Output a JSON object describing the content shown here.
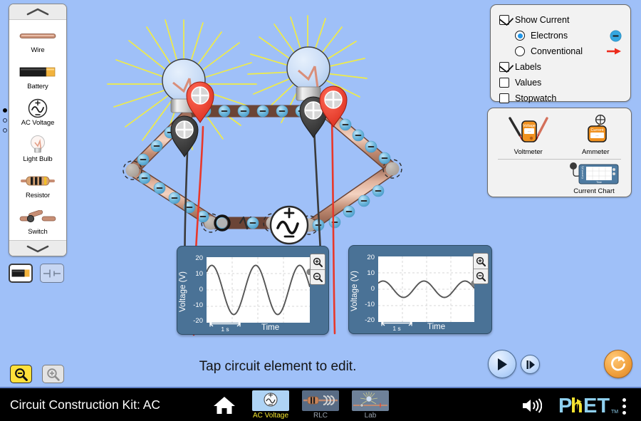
{
  "app": {
    "title": "Circuit Construction Kit: AC",
    "background_color": "#9fc0f8",
    "hint": "Tap circuit element to edit."
  },
  "carousel": {
    "up_arrow_icon": "chevron-up-icon",
    "down_arrow_icon": "chevron-down-icon",
    "items": [
      {
        "label": "Wire",
        "icon": "wire-icon"
      },
      {
        "label": "Battery",
        "icon": "battery-icon"
      },
      {
        "label": "AC Voltage",
        "icon": "ac-voltage-icon"
      },
      {
        "label": "Light Bulb",
        "icon": "light-bulb-icon"
      },
      {
        "label": "Resistor",
        "icon": "resistor-icon"
      },
      {
        "label": "Switch",
        "icon": "switch-icon"
      }
    ],
    "page_dots": [
      true,
      false,
      false
    ]
  },
  "view_toggles": [
    {
      "name": "lifelike-view",
      "icon": "battery-lifelike-icon",
      "selected": true
    },
    {
      "name": "schematic-view",
      "icon": "battery-schematic-icon",
      "selected": false
    }
  ],
  "controls": {
    "show_current": {
      "label": "Show Current",
      "checked": true
    },
    "current_type": {
      "selected": "Electrons",
      "options": [
        {
          "label": "Electrons",
          "selected": true,
          "icon": "electron-icon",
          "color": "#2196e8"
        },
        {
          "label": "Conventional",
          "selected": false,
          "icon": "red-arrow-icon",
          "color": "#e82b1e"
        }
      ]
    },
    "labels": {
      "label": "Labels",
      "checked": true
    },
    "values": {
      "label": "Values",
      "checked": false
    },
    "stopwatch": {
      "label": "Stopwatch",
      "checked": false
    }
  },
  "sensors": [
    {
      "label": "Voltmeter",
      "icon": "voltmeter-icon",
      "display_text": "Voltage"
    },
    {
      "label": "Ammeter",
      "icon": "ammeter-icon",
      "display_text": "Current"
    },
    {
      "label": "Current Chart",
      "icon": "current-chart-icon"
    }
  ],
  "charts": [
    {
      "name": "voltage-chart-1",
      "chart_data": {
        "type": "line",
        "title": "",
        "xlabel": "Time",
        "ylabel": "Voltage (V)",
        "yticks": [
          20,
          10,
          0,
          -10,
          -20
        ],
        "ylim": [
          -20,
          20
        ],
        "scale_bar_label": "1 s",
        "amplitude": 15,
        "cycles": 2.35,
        "phase_deg": 47,
        "end_marker_value": 11,
        "grid": true,
        "series": [
          {
            "name": "voltage",
            "color": "#555555"
          }
        ]
      },
      "zoom_in_icon": "zoom-in-icon",
      "zoom_out_icon": "zoom-out-icon"
    },
    {
      "name": "voltage-chart-2",
      "chart_data": {
        "type": "line",
        "title": "",
        "xlabel": "Time",
        "ylabel": "Voltage (V)",
        "yticks": [
          20,
          10,
          0,
          -10,
          -20
        ],
        "ylim": [
          -20,
          20
        ],
        "scale_bar_label": "1 s",
        "amplitude": 5,
        "cycles": 2.35,
        "phase_deg": 47,
        "end_marker_value": 3.6,
        "grid": true,
        "series": [
          {
            "name": "voltage",
            "color": "#555555"
          }
        ]
      },
      "zoom_in_icon": "zoom-in-icon",
      "zoom_out_icon": "zoom-out-icon"
    }
  ],
  "zoom_controls": {
    "zoom_out": {
      "icon": "zoom-out-icon",
      "active": true,
      "color": "#ffe03a"
    },
    "zoom_in": {
      "icon": "zoom-in-icon",
      "active": false,
      "color": "#e3e3e3"
    }
  },
  "sim_controls": {
    "play": {
      "icon": "play-icon",
      "name": "play-button"
    },
    "step": {
      "icon": "step-forward-icon",
      "name": "step-forward-button"
    },
    "reset": {
      "icon": "reset-icon",
      "name": "reset-all-button",
      "color": "#f0a03c"
    }
  },
  "navbar": {
    "home_icon": "home-icon",
    "speaker_icon": "speaker-icon",
    "kebab_icon": "kebab-menu-icon",
    "logo": {
      "part1": "P",
      "part2": "h",
      "part3": "ET",
      "tm": "TM"
    },
    "tabs": [
      {
        "label": "AC Voltage",
        "selected": true
      },
      {
        "label": "RLC",
        "selected": false
      },
      {
        "label": "Lab",
        "selected": false
      }
    ]
  },
  "circuit": {
    "components": [
      {
        "type": "light-bulb",
        "label": "left-light-bulb",
        "lit": true
      },
      {
        "type": "light-bulb",
        "label": "right-light-bulb",
        "lit": true
      },
      {
        "type": "wire",
        "label": "top-wire"
      },
      {
        "type": "wire",
        "label": "left-upper-wire"
      },
      {
        "type": "wire",
        "label": "left-lower-wire"
      },
      {
        "type": "wire",
        "label": "right-upper-wire"
      },
      {
        "type": "wire",
        "label": "right-lower-wire"
      },
      {
        "type": "switch",
        "label": "switch-closed"
      },
      {
        "type": "resistor",
        "label": "resistor"
      },
      {
        "type": "ac-voltage-source",
        "label": "ac-source"
      }
    ],
    "probes": [
      {
        "type": "voltmeter-probe",
        "polarity": "positive",
        "color": "#e8382a"
      },
      {
        "type": "voltmeter-probe",
        "polarity": "negative",
        "color": "#3a3a3a"
      }
    ]
  }
}
